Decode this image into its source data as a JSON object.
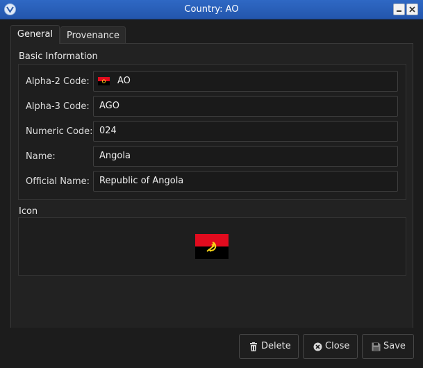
{
  "window": {
    "title": "Country: AO"
  },
  "tabs": [
    {
      "label": "General"
    },
    {
      "label": "Provenance"
    }
  ],
  "basic_info": {
    "title": "Basic Information",
    "fields": [
      {
        "label": "Alpha-2 Code:",
        "value": "AO"
      },
      {
        "label": "Alpha-3 Code:",
        "value": "AGO"
      },
      {
        "label": "Numeric Code:",
        "value": "024"
      },
      {
        "label": "Name:",
        "value": "Angola"
      },
      {
        "label": "Official Name:",
        "value": "Republic of Angola"
      }
    ]
  },
  "icon_section": {
    "title": "Icon"
  },
  "buttons": {
    "delete": "Delete",
    "close": "Close",
    "save": "Save"
  },
  "colors": {
    "titlebar": "#2f68c4",
    "flag_red": "#e20b1e",
    "flag_black": "#000000",
    "flag_emblem": "#f9d616"
  }
}
